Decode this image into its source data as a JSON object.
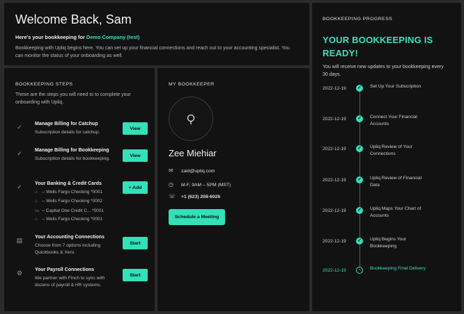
{
  "welcome": {
    "title": "Welcome Back, Sam",
    "subhead_prefix": "Here's your bookkeeping for",
    "company": "Demo Company (test)",
    "body": "Bookkeeping with Upliq begins here. You can set up your financial connections and reach out to your accounting specialist. You can monitor the status of your onboarding as well."
  },
  "steps": {
    "label": "BOOKKEEPING STEPS",
    "description": "These are the steps you will need to to complete your onboarding with Upliq.",
    "items": [
      {
        "title": "Manage Billing for Catchup",
        "desc": "Subscription details for catchup.",
        "button": "View",
        "icon": "check-icon"
      },
      {
        "title": "Manage Billing for Bookkeeping",
        "desc": "Subscription details for bookkeeping.",
        "button": "View",
        "icon": "check-icon"
      },
      {
        "title": "Your Banking & Credit Cards",
        "desc": "",
        "button": "+ Add",
        "icon": "check-icon"
      },
      {
        "title": "Your Accounting Connections",
        "desc": "Choose from 7 options including Quickbooks & Xero.",
        "button": "Start",
        "icon": "ledger-icon"
      },
      {
        "title": "Your Payroll Connections",
        "desc": "We partner with Finch to sync with dozens of payroll & HR systems.",
        "button": "Start",
        "icon": "payroll-icon"
      }
    ],
    "accounts": [
      {
        "name": "-- Wells Fargo Checking *0001",
        "icon": "bank-icon"
      },
      {
        "name": "-- Wells Fargo Checking *0002",
        "icon": "bank-icon"
      },
      {
        "name": "-- Capital One Credit C...   *0001",
        "icon": "card-icon"
      },
      {
        "name": "-- Wells Fargo Checking *0001",
        "icon": "bank-icon"
      }
    ]
  },
  "keeper": {
    "label": "MY BOOKKEEPER",
    "name": "Zee Miehiar",
    "email": "zaid@upliq.com",
    "hours": "M-F, 9AM – 5PM (MST)",
    "phone": "+1 (623) 208-6026",
    "schedule_button": "Schedule a Meeting"
  },
  "progress": {
    "label": "BOOKKEEPING PROGRESS",
    "headline": "YOUR BOOKKEEPING IS READY!",
    "body": "You will receive new updates to your bookkeeping every 30 days.",
    "timeline": [
      {
        "date": "2022-12-19",
        "text": "Set Up Your Subscription"
      },
      {
        "date": "2022-12-19",
        "text": "Connect Your Financial Accounts"
      },
      {
        "date": "2022-12-19",
        "text": "Upliq Review of Your Connections"
      },
      {
        "date": "2022-12-19",
        "text": "Upliq Review of Financial Data"
      },
      {
        "date": "2022-12-19",
        "text": "Upliq Maps Your Chart of Accounts"
      },
      {
        "date": "2022-12-19",
        "text": "Upliq Begins Your Bookkeeping"
      },
      {
        "date": "2022-12-19",
        "text": "Bookkeeping Final Delivery"
      }
    ]
  },
  "colors": {
    "accent": "#33e0b8",
    "panel": "#121212",
    "background": "#2b2b2b"
  }
}
